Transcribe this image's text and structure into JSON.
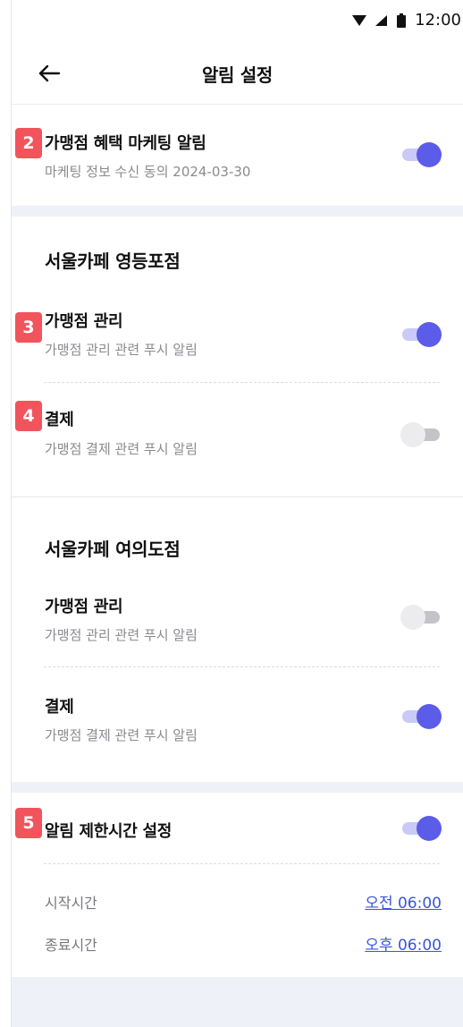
{
  "status_bar": {
    "time": "12:00",
    "icons": [
      "wifi-icon",
      "signal-icon",
      "battery-icon"
    ]
  },
  "app_bar": {
    "title": "알림 설정",
    "back_icon": "back-arrow-icon"
  },
  "marketing": {
    "badge": "2",
    "title": "가맹점 혜택 마케팅 알림",
    "subtitle": "마케팅 정보 수신 동의 2024-03-30",
    "toggle_on": true
  },
  "stores": [
    {
      "name": "서울카페 영등포점",
      "items": [
        {
          "badge": "3",
          "title": "가맹점 관리",
          "subtitle": "가맹점 관리 관련 푸시 알림",
          "toggle_on": true
        },
        {
          "badge": "4",
          "title": "결제",
          "subtitle": "가맹점 결제 관련 푸시 알림",
          "toggle_on": false
        }
      ]
    },
    {
      "name": "서울카페 여의도점",
      "items": [
        {
          "title": "가맹점 관리",
          "subtitle": "가맹점 관리 관련 푸시 알림",
          "toggle_on": false
        },
        {
          "title": "결제",
          "subtitle": "가맹점 결제 관련 푸시 알림",
          "toggle_on": true
        }
      ]
    }
  ],
  "quiet_hours": {
    "badge": "5",
    "title": "알림 제한시간 설정",
    "toggle_on": true,
    "start_label": "시작시간",
    "start_value": "오전 06:00",
    "end_label": "종료시간",
    "end_value": "오후 06:00"
  },
  "colors": {
    "accent": "#5b5ce8",
    "accent_track": "#c9caf7",
    "badge": "#f2545b",
    "link": "#3b55d9",
    "section_bg": "#eef1f8"
  }
}
